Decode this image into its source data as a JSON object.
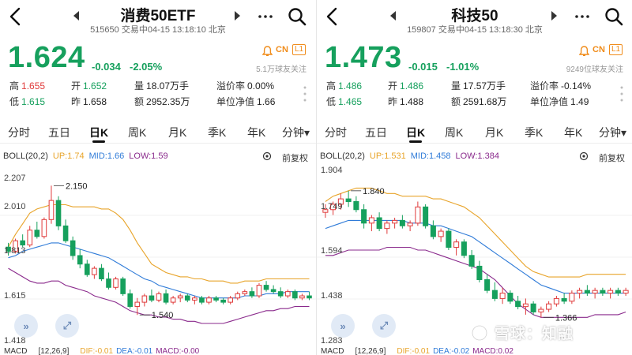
{
  "panels": [
    {
      "title": "消费50ETF",
      "code": "515650",
      "status_line": "交易中04-15 13:18:10 北京",
      "price": "1.624",
      "change": "-0.034",
      "change_pct": "-2.05%",
      "followers": "5.1万球友关注",
      "badge_cn": "CN",
      "badge_l1": "L1",
      "stats": {
        "high_label": "高",
        "high": "1.655",
        "open_label": "开",
        "open": "1.652",
        "vol_label": "量",
        "vol": "18.07万手",
        "prem_label": "溢价率",
        "prem": "0.00%",
        "low_label": "低",
        "low": "1.615",
        "prev_label": "昨",
        "prev": "1.658",
        "amt_label": "额",
        "amt": "2952.35万",
        "nav_label": "单位净值",
        "nav": "1.66"
      },
      "tabs": [
        "分时",
        "五日",
        "日K",
        "周K",
        "月K",
        "季K",
        "年K",
        "分钟▾"
      ],
      "active_tab": 2,
      "boll": {
        "name": "BOLL(20,2)",
        "up": "UP:1.74",
        "mid": "MID:1.66",
        "low": "LOW:1.59"
      },
      "adjust": "前复权",
      "y_labels": [
        "2.207",
        "2.010",
        "1.813",
        "1.615",
        "1.418"
      ],
      "high_mark": "2.150",
      "low_mark": "1.540",
      "macd": {
        "name": "MACD",
        "params": "[12,26,9]",
        "dif": "DIF:-0.01",
        "dea": "DEA:-0.01",
        "m": "MACD:-0.00"
      },
      "chart_data": {
        "type": "candlestick",
        "ylim": [
          1.418,
          2.207
        ],
        "candles": [
          [
            1.86,
            1.88,
            1.82,
            1.84
          ],
          [
            1.84,
            1.9,
            1.83,
            1.89
          ],
          [
            1.89,
            1.92,
            1.86,
            1.87
          ],
          [
            1.87,
            1.96,
            1.86,
            1.94
          ],
          [
            1.94,
            1.98,
            1.9,
            1.91
          ],
          [
            1.91,
            2.0,
            1.9,
            1.99
          ],
          [
            1.99,
            2.15,
            1.97,
            2.08
          ],
          [
            2.08,
            2.1,
            1.94,
            1.96
          ],
          [
            1.96,
            1.99,
            1.88,
            1.89
          ],
          [
            1.89,
            1.91,
            1.8,
            1.82
          ],
          [
            1.82,
            1.85,
            1.76,
            1.78
          ],
          [
            1.78,
            1.8,
            1.72,
            1.73
          ],
          [
            1.73,
            1.77,
            1.71,
            1.76
          ],
          [
            1.76,
            1.78,
            1.7,
            1.71
          ],
          [
            1.71,
            1.74,
            1.66,
            1.67
          ],
          [
            1.67,
            1.72,
            1.66,
            1.71
          ],
          [
            1.71,
            1.72,
            1.63,
            1.64
          ],
          [
            1.64,
            1.66,
            1.57,
            1.58
          ],
          [
            1.58,
            1.62,
            1.54,
            1.6
          ],
          [
            1.6,
            1.64,
            1.58,
            1.63
          ],
          [
            1.63,
            1.66,
            1.6,
            1.61
          ],
          [
            1.61,
            1.65,
            1.6,
            1.64
          ],
          [
            1.64,
            1.66,
            1.59,
            1.6
          ],
          [
            1.6,
            1.63,
            1.59,
            1.62
          ],
          [
            1.62,
            1.64,
            1.6,
            1.63
          ],
          [
            1.63,
            1.64,
            1.6,
            1.61
          ],
          [
            1.61,
            1.63,
            1.59,
            1.62
          ],
          [
            1.62,
            1.63,
            1.59,
            1.6
          ],
          [
            1.6,
            1.63,
            1.59,
            1.62
          ],
          [
            1.62,
            1.63,
            1.6,
            1.61
          ],
          [
            1.61,
            1.62,
            1.59,
            1.6
          ],
          [
            1.6,
            1.63,
            1.59,
            1.62
          ],
          [
            1.62,
            1.65,
            1.61,
            1.64
          ],
          [
            1.64,
            1.66,
            1.63,
            1.65
          ],
          [
            1.65,
            1.67,
            1.62,
            1.63
          ],
          [
            1.63,
            1.69,
            1.62,
            1.68
          ],
          [
            1.68,
            1.7,
            1.65,
            1.66
          ],
          [
            1.66,
            1.68,
            1.64,
            1.65
          ],
          [
            1.65,
            1.67,
            1.62,
            1.63
          ],
          [
            1.63,
            1.66,
            1.62,
            1.65
          ],
          [
            1.65,
            1.66,
            1.61,
            1.62
          ],
          [
            1.62,
            1.64,
            1.61,
            1.63
          ],
          [
            1.63,
            1.65,
            1.61,
            1.62
          ]
        ],
        "upper": [
          1.86,
          1.92,
          1.97,
          2.02,
          2.04,
          2.05,
          2.06,
          2.06,
          2.06,
          2.05,
          2.05,
          2.05,
          2.05,
          2.04,
          2.04,
          2.02,
          1.99,
          1.94,
          1.88,
          1.83,
          1.78,
          1.76,
          1.74,
          1.73,
          1.72,
          1.72,
          1.71,
          1.71,
          1.7,
          1.7,
          1.7,
          1.69,
          1.69,
          1.7,
          1.7,
          1.7,
          1.71,
          1.71,
          1.71,
          1.71,
          1.71,
          1.71,
          1.71
        ],
        "middle": [
          1.81,
          1.82,
          1.84,
          1.85,
          1.86,
          1.87,
          1.88,
          1.88,
          1.87,
          1.86,
          1.85,
          1.84,
          1.83,
          1.82,
          1.81,
          1.79,
          1.77,
          1.75,
          1.73,
          1.71,
          1.7,
          1.68,
          1.67,
          1.66,
          1.65,
          1.64,
          1.63,
          1.62,
          1.62,
          1.62,
          1.62,
          1.62,
          1.62,
          1.63,
          1.63,
          1.63,
          1.64,
          1.64,
          1.64,
          1.65,
          1.65,
          1.65,
          1.65
        ],
        "lower": [
          1.76,
          1.74,
          1.72,
          1.7,
          1.69,
          1.69,
          1.7,
          1.7,
          1.68,
          1.67,
          1.66,
          1.65,
          1.63,
          1.62,
          1.61,
          1.6,
          1.58,
          1.56,
          1.55,
          1.54,
          1.54,
          1.53,
          1.53,
          1.52,
          1.52,
          1.51,
          1.51,
          1.5,
          1.5,
          1.5,
          1.5,
          1.51,
          1.52,
          1.53,
          1.54,
          1.55,
          1.56,
          1.56,
          1.57,
          1.57,
          1.58,
          1.58,
          1.58
        ],
        "high_index": 6,
        "low_index": 18
      },
      "colors": {
        "up": "#e03a3a",
        "down": "#16a05d",
        "upper": "#e8a42a",
        "middle": "#2f7bd8",
        "lower": "#8a2a8c"
      }
    },
    {
      "title": "科技50",
      "code": "159807",
      "status_line": "交易中04-15 13:18:30 北京",
      "price": "1.473",
      "change": "-0.015",
      "change_pct": "-1.01%",
      "followers": "9249位球友关注",
      "badge_cn": "CN",
      "badge_l1": "L1",
      "stats": {
        "high_label": "高",
        "high": "1.486",
        "open_label": "开",
        "open": "1.486",
        "vol_label": "量",
        "vol": "17.57万手",
        "prem_label": "溢价率",
        "prem": "-0.14%",
        "low_label": "低",
        "low": "1.465",
        "prev_label": "昨",
        "prev": "1.488",
        "amt_label": "额",
        "amt": "2591.68万",
        "nav_label": "单位净值",
        "nav": "1.49"
      },
      "tabs": [
        "分时",
        "五日",
        "日K",
        "周K",
        "月K",
        "季K",
        "年K",
        "分钟▾"
      ],
      "active_tab": 2,
      "boll": {
        "name": "BOLL(20,2)",
        "up": "UP:1.531",
        "mid": "MID:1.458",
        "low": "LOW:1.384"
      },
      "adjust": "前复权",
      "y_labels": [
        "1.904",
        "1.749",
        "1.594",
        "1.438",
        "1.283"
      ],
      "high_mark": "1.840",
      "low_mark": "1.366",
      "macd": {
        "name": "MACD",
        "params": "[12,26,9]",
        "dif": "DIF:-0.01",
        "dea": "DEA:-0.02",
        "m": "MACD:0.02"
      },
      "chart_data": {
        "type": "candlestick",
        "ylim": [
          1.283,
          1.904
        ],
        "candles": [
          [
            1.76,
            1.79,
            1.74,
            1.77
          ],
          [
            1.77,
            1.8,
            1.75,
            1.79
          ],
          [
            1.79,
            1.83,
            1.77,
            1.81
          ],
          [
            1.81,
            1.84,
            1.78,
            1.8
          ],
          [
            1.8,
            1.82,
            1.76,
            1.77
          ],
          [
            1.77,
            1.79,
            1.7,
            1.72
          ],
          [
            1.72,
            1.75,
            1.69,
            1.74
          ],
          [
            1.74,
            1.76,
            1.69,
            1.7
          ],
          [
            1.7,
            1.73,
            1.68,
            1.72
          ],
          [
            1.72,
            1.74,
            1.7,
            1.73
          ],
          [
            1.73,
            1.75,
            1.7,
            1.71
          ],
          [
            1.71,
            1.73,
            1.69,
            1.72
          ],
          [
            1.72,
            1.8,
            1.71,
            1.78
          ],
          [
            1.78,
            1.79,
            1.7,
            1.71
          ],
          [
            1.71,
            1.73,
            1.66,
            1.67
          ],
          [
            1.67,
            1.7,
            1.65,
            1.69
          ],
          [
            1.69,
            1.7,
            1.62,
            1.63
          ],
          [
            1.63,
            1.66,
            1.6,
            1.65
          ],
          [
            1.65,
            1.66,
            1.59,
            1.6
          ],
          [
            1.6,
            1.62,
            1.55,
            1.56
          ],
          [
            1.56,
            1.58,
            1.5,
            1.51
          ],
          [
            1.51,
            1.53,
            1.46,
            1.47
          ],
          [
            1.47,
            1.5,
            1.43,
            1.44
          ],
          [
            1.44,
            1.48,
            1.42,
            1.46
          ],
          [
            1.46,
            1.47,
            1.42,
            1.43
          ],
          [
            1.43,
            1.45,
            1.4,
            1.41
          ],
          [
            1.41,
            1.44,
            1.38,
            1.42
          ],
          [
            1.42,
            1.43,
            1.38,
            1.39
          ],
          [
            1.39,
            1.41,
            1.37,
            1.4
          ],
          [
            1.4,
            1.43,
            1.39,
            1.42
          ],
          [
            1.42,
            1.45,
            1.41,
            1.44
          ],
          [
            1.44,
            1.46,
            1.42,
            1.43
          ],
          [
            1.43,
            1.47,
            1.42,
            1.46
          ],
          [
            1.46,
            1.48,
            1.44,
            1.47
          ],
          [
            1.47,
            1.49,
            1.45,
            1.46
          ],
          [
            1.46,
            1.48,
            1.44,
            1.47
          ],
          [
            1.47,
            1.48,
            1.45,
            1.46
          ],
          [
            1.46,
            1.48,
            1.44,
            1.47
          ],
          [
            1.47,
            1.48,
            1.45,
            1.46
          ],
          [
            1.46,
            1.48,
            1.45,
            1.47
          ]
        ],
        "upper": [
          1.8,
          1.82,
          1.83,
          1.84,
          1.85,
          1.85,
          1.85,
          1.84,
          1.83,
          1.83,
          1.82,
          1.82,
          1.82,
          1.82,
          1.81,
          1.81,
          1.8,
          1.79,
          1.78,
          1.76,
          1.74,
          1.71,
          1.68,
          1.65,
          1.62,
          1.59,
          1.56,
          1.54,
          1.53,
          1.52,
          1.52,
          1.52,
          1.52,
          1.52,
          1.53,
          1.53,
          1.53,
          1.53,
          1.53,
          1.53
        ],
        "middle": [
          1.7,
          1.71,
          1.72,
          1.73,
          1.73,
          1.73,
          1.73,
          1.73,
          1.73,
          1.73,
          1.73,
          1.72,
          1.72,
          1.72,
          1.71,
          1.71,
          1.7,
          1.69,
          1.68,
          1.67,
          1.65,
          1.63,
          1.61,
          1.59,
          1.57,
          1.55,
          1.53,
          1.51,
          1.49,
          1.48,
          1.47,
          1.46,
          1.46,
          1.46,
          1.46,
          1.46,
          1.46,
          1.46,
          1.46,
          1.46
        ],
        "lower": [
          1.6,
          1.6,
          1.61,
          1.62,
          1.62,
          1.62,
          1.62,
          1.62,
          1.63,
          1.63,
          1.63,
          1.63,
          1.62,
          1.62,
          1.61,
          1.6,
          1.59,
          1.58,
          1.57,
          1.56,
          1.55,
          1.53,
          1.51,
          1.48,
          1.45,
          1.42,
          1.4,
          1.38,
          1.37,
          1.37,
          1.37,
          1.37,
          1.37,
          1.37,
          1.37,
          1.38,
          1.38,
          1.38,
          1.38,
          1.39
        ],
        "high_index": 3,
        "low_index": 28
      },
      "colors": {
        "up": "#e03a3a",
        "down": "#16a05d",
        "upper": "#e8a42a",
        "middle": "#2f7bd8",
        "lower": "#8a2a8c"
      }
    }
  ],
  "watermark": "雪球：知融"
}
